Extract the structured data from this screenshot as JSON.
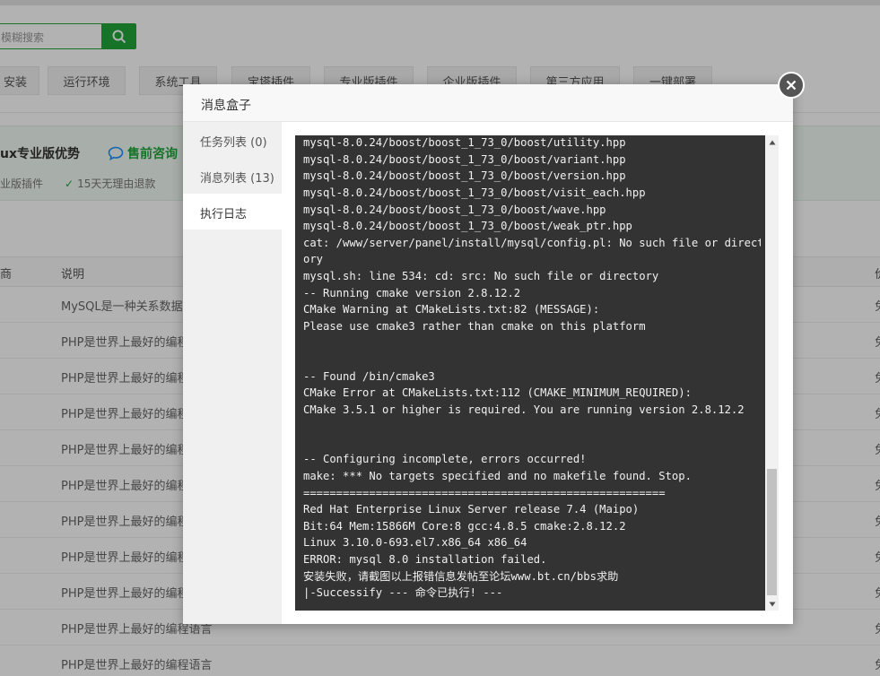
{
  "background": {
    "search_placeholder": "模糊搜索",
    "tabs": [
      "安装",
      "运行环境",
      "系统工具",
      "宝塔插件",
      "专业版插件",
      "企业版插件",
      "第三方应用",
      "一键部署"
    ],
    "promo": {
      "title": "ux专业版优势",
      "consult": "售前咨询",
      "feature1": "业版插件",
      "feature2": "15天无理由退款"
    },
    "table_headers": {
      "col1": "商",
      "col2": "说明",
      "col3": "价"
    },
    "rows": [
      {
        "desc": "MySQL是一种关系数据库",
        "right": "免"
      },
      {
        "desc": "PHP是世界上最好的编程语言",
        "right": "免"
      },
      {
        "desc": "PHP是世界上最好的编程语言",
        "right": "免"
      },
      {
        "desc": "PHP是世界上最好的编程语言",
        "right": "免"
      },
      {
        "desc": "PHP是世界上最好的编程语言",
        "right": "免"
      },
      {
        "desc": "PHP是世界上最好的编程语言",
        "right": "免"
      },
      {
        "desc": "PHP是世界上最好的编程语言",
        "right": "免"
      },
      {
        "desc": "PHP是世界上最好的编程语言",
        "right": "免"
      },
      {
        "desc": "PHP是世界上最好的编程语言",
        "right": "免"
      },
      {
        "desc": "PHP是世界上最好的编程语言",
        "right": "免"
      },
      {
        "desc": "PHP是世界上最好的编程语言",
        "right": "免"
      }
    ]
  },
  "modal": {
    "title": "消息盒子",
    "tabs": [
      {
        "label": "任务列表 (0)"
      },
      {
        "label": "消息列表 (13)"
      },
      {
        "label": "执行日志"
      }
    ],
    "log_lines": [
      "mysql-8.0.24/boost/boost_1_73_0/boost/utility.hpp",
      "mysql-8.0.24/boost/boost_1_73_0/boost/variant.hpp",
      "mysql-8.0.24/boost/boost_1_73_0/boost/version.hpp",
      "mysql-8.0.24/boost/boost_1_73_0/boost/visit_each.hpp",
      "mysql-8.0.24/boost/boost_1_73_0/boost/wave.hpp",
      "mysql-8.0.24/boost/boost_1_73_0/boost/weak_ptr.hpp",
      "cat: /www/server/panel/install/mysql/config.pl: No such file or direct",
      "ory",
      "mysql.sh: line 534: cd: src: No such file or directory",
      "-- Running cmake version 2.8.12.2",
      "CMake Warning at CMakeLists.txt:82 (MESSAGE):",
      "Please use cmake3 rather than cmake on this platform",
      "",
      "",
      "-- Found /bin/cmake3",
      "CMake Error at CMakeLists.txt:112 (CMAKE_MINIMUM_REQUIRED):",
      "CMake 3.5.1 or higher is required. You are running version 2.8.12.2",
      "",
      "",
      "-- Configuring incomplete, errors occurred!",
      "make: *** No targets specified and no makefile found. Stop.",
      "=======================================================",
      "Red Hat Enterprise Linux Server release 7.4 (Maipo)",
      "Bit:64 Mem:15866M Core:8 gcc:4.8.5 cmake:2.8.12.2",
      "Linux 3.10.0-693.el7.x86_64 x86_64",
      "ERROR: mysql 8.0 installation failed.",
      "安装失败，请截图以上报错信息发帖至论坛www.bt.cn/bbs求助",
      "|-Successify --- 命令已执行! ---"
    ]
  },
  "colors": {
    "brand_green": "#20a53a",
    "terminal_bg": "#333333",
    "terminal_text": "#f0f0f0"
  }
}
